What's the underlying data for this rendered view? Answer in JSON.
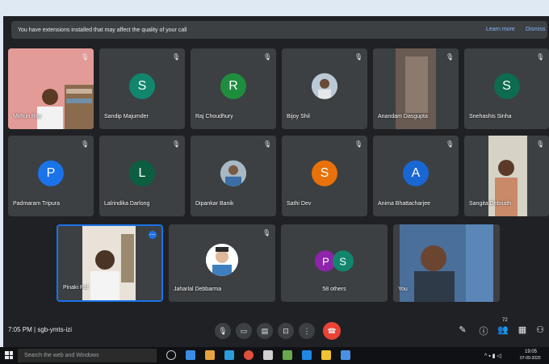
{
  "banner": {
    "text": "You have extensions installed that may affect the quality of your call",
    "learn_more": "Learn more",
    "dismiss": "Dismiss"
  },
  "participants": [
    {
      "name": "Mithun Ray",
      "type": "photo"
    },
    {
      "name": "Sandip Majumder",
      "type": "avatar",
      "letter": "S",
      "color": "#12866d"
    },
    {
      "name": "Raj Choudhury",
      "type": "avatar",
      "letter": "R",
      "color": "#1e8e3e"
    },
    {
      "name": "Bijoy Shil",
      "type": "photo"
    },
    {
      "name": "Anandam Dasgupta",
      "type": "photo"
    },
    {
      "name": "Snehashis Sinha",
      "type": "avatar",
      "letter": "S",
      "color": "#0d6b4f"
    },
    {
      "name": "Padmaram Tripura",
      "type": "avatar",
      "letter": "P",
      "color": "#1a73e8"
    },
    {
      "name": "Lalrindika Darlong",
      "type": "avatar",
      "letter": "L",
      "color": "#0b5f40"
    },
    {
      "name": "Dipankar Banik",
      "type": "photo"
    },
    {
      "name": "Sathi Dev",
      "type": "avatar",
      "letter": "S",
      "color": "#e8710a"
    },
    {
      "name": "Anima Bhattacharjee",
      "type": "avatar",
      "letter": "A",
      "color": "#1967d2"
    },
    {
      "name": "Sangita Debnath",
      "type": "photo"
    },
    {
      "name": "Pinaki Pal",
      "type": "photo"
    },
    {
      "name": "Jaharlal Debbarma",
      "type": "photo"
    },
    {
      "name": "58 others",
      "type": "others",
      "letters": [
        "P",
        "S"
      ]
    },
    {
      "name": "You",
      "type": "photo"
    }
  ],
  "bottom_bar": {
    "time": "7:05 PM",
    "meeting_code": "sgb-ymts-izi",
    "participant_count": "72"
  },
  "taskbar": {
    "search_placeholder": "Search the web and Windows",
    "clock_time": "19:05",
    "clock_date": "07-09-2020"
  },
  "colors": {
    "meet_bg": "#202124",
    "tile_bg": "#3c4043",
    "end_call": "#ea4335",
    "accent_link": "#8ab4f8"
  }
}
